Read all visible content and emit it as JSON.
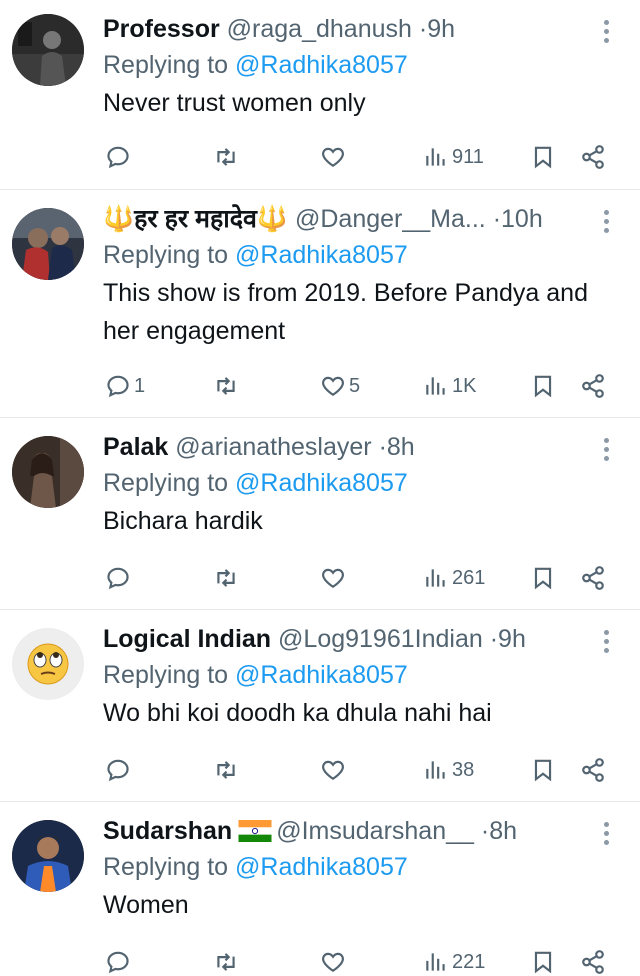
{
  "tweets": [
    {
      "name": "Professor",
      "handle": "@raga_dhanush",
      "time": "9h",
      "replying_prefix": "Replying to",
      "replying_to": "@Radhika8057",
      "text": "Never trust women only",
      "replies": "",
      "retweets": "",
      "likes": "",
      "views": "911",
      "avatar": "dark-silhouette"
    },
    {
      "name": "🔱हर हर महादेव🔱",
      "handle": "@Danger__Ma...",
      "time": "10h",
      "replying_prefix": "Replying to",
      "replying_to": "@Radhika8057",
      "text": "This show is from 2019. Before Pandya and her engagement",
      "replies": "1",
      "retweets": "",
      "likes": "5",
      "views": "1K",
      "avatar": "two-people-photo"
    },
    {
      "name": "Palak",
      "handle": "@arianatheslayer",
      "time": "8h",
      "replying_prefix": "Replying to",
      "replying_to": "@Radhika8057",
      "text": "Bichara hardik",
      "replies": "",
      "retweets": "",
      "likes": "",
      "views": "261",
      "avatar": "woman-photo"
    },
    {
      "name": "Logical Indian",
      "handle": "@Log91961Indian",
      "time": "9h",
      "replying_prefix": "Replying to",
      "replying_to": "@Radhika8057",
      "text": "Wo bhi koi doodh ka dhula nahi hai",
      "replies": "",
      "retweets": "",
      "likes": "",
      "views": "38",
      "avatar": "eye-roll-emoji"
    },
    {
      "name": "Sudarshan",
      "handle": "@Imsudarshan__",
      "time": "8h",
      "replying_prefix": "Replying to",
      "replying_to": "@Radhika8057",
      "text": "Women",
      "replies": "",
      "retweets": "",
      "likes": "",
      "views": "221",
      "avatar": "cricketer-photo"
    }
  ],
  "colors": {
    "text": "#0f1419",
    "secondary": "#536471",
    "link": "#1d9bf0",
    "divider": "#e6e9eb"
  },
  "icons": [
    "reply-icon",
    "retweet-icon",
    "like-icon",
    "views-icon",
    "bookmark-icon",
    "share-icon",
    "more-icon",
    "india-flag-icon",
    "trident-icon"
  ]
}
